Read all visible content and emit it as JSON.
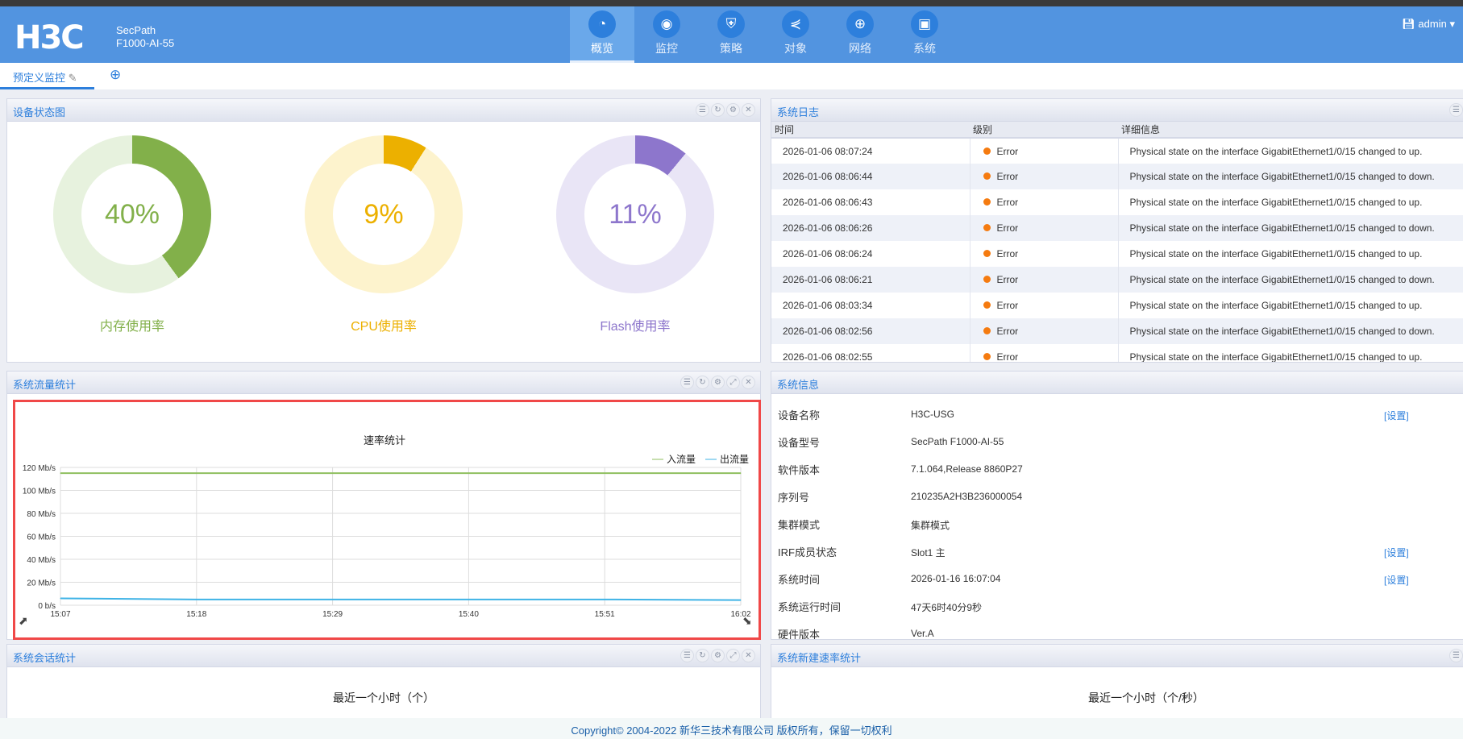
{
  "header": {
    "logo": "H3C",
    "product_line1": "SecPath",
    "product_line2": "F1000-AI-55",
    "user": "admin",
    "nav": [
      {
        "label": "概览",
        "icon": "dashboard-icon",
        "glyph": "◔"
      },
      {
        "label": "监控",
        "icon": "webcam-icon",
        "glyph": "◉"
      },
      {
        "label": "策略",
        "icon": "shield-icon",
        "glyph": "⛨"
      },
      {
        "label": "对象",
        "icon": "share-icon",
        "glyph": "⋞"
      },
      {
        "label": "网络",
        "icon": "globe-icon",
        "glyph": "⊕"
      },
      {
        "label": "系统",
        "icon": "monitor-icon",
        "glyph": "▣"
      }
    ]
  },
  "tabs": {
    "active": "预定义监控",
    "add": "⊕"
  },
  "device_status": {
    "title": "设备状态图",
    "gauges": [
      {
        "label": "内存使用率",
        "value": 40,
        "text": "40%",
        "color": "#82b04a",
        "track": "#e7f2de"
      },
      {
        "label": "CPU使用率",
        "value": 9,
        "text": "9%",
        "color": "#ecb000",
        "track": "#fdf3cd"
      },
      {
        "label": "Flash使用率",
        "value": 11,
        "text": "11%",
        "color": "#8d76cc",
        "track": "#e9e5f6"
      }
    ]
  },
  "syslog": {
    "title": "系统日志",
    "columns": [
      "时间",
      "级别",
      "详细信息"
    ],
    "rows": [
      [
        "2026-01-06 08:07:24",
        "Error",
        "Physical state on the interface GigabitEthernet1/0/15 changed to up."
      ],
      [
        "2026-01-06 08:06:44",
        "Error",
        "Physical state on the interface GigabitEthernet1/0/15 changed to down."
      ],
      [
        "2026-01-06 08:06:43",
        "Error",
        "Physical state on the interface GigabitEthernet1/0/15 changed to up."
      ],
      [
        "2026-01-06 08:06:26",
        "Error",
        "Physical state on the interface GigabitEthernet1/0/15 changed to down."
      ],
      [
        "2026-01-06 08:06:24",
        "Error",
        "Physical state on the interface GigabitEthernet1/0/15 changed to up."
      ],
      [
        "2026-01-06 08:06:21",
        "Error",
        "Physical state on the interface GigabitEthernet1/0/15 changed to down."
      ],
      [
        "2026-01-06 08:03:34",
        "Error",
        "Physical state on the interface GigabitEthernet1/0/15 changed to up."
      ],
      [
        "2026-01-06 08:02:56",
        "Error",
        "Physical state on the interface GigabitEthernet1/0/15 changed to down."
      ],
      [
        "2026-01-06 08:02:55",
        "Error",
        "Physical state on the interface GigabitEthernet1/0/15 changed to up."
      ]
    ]
  },
  "traffic": {
    "title": "系统流量统计"
  },
  "chart_data": {
    "type": "line",
    "title": "速率统计",
    "xlabel": "",
    "ylabel": "",
    "x": [
      "15:07",
      "15:18",
      "15:29",
      "15:40",
      "15:51",
      "16:02"
    ],
    "yticks": [
      "0 b/s",
      "20 Mb/s",
      "40 Mb/s",
      "60 Mb/s",
      "80 Mb/s",
      "100 Mb/s",
      "120 Mb/s"
    ],
    "ylim": [
      0,
      120
    ],
    "legend_position": "top-right",
    "series": [
      {
        "name": "入流量",
        "color": "#8fbf5f",
        "values": [
          115,
          115,
          115,
          115,
          115,
          115
        ]
      },
      {
        "name": "出流量",
        "color": "#3fb3e6",
        "values": [
          6,
          5,
          5,
          5,
          5,
          4.5
        ]
      }
    ]
  },
  "sysinfo": {
    "title": "系统信息",
    "link": "[设置]",
    "rows": [
      {
        "label": "设备名称",
        "value": "H3C-USG",
        "link": true
      },
      {
        "label": "设备型号",
        "value": "SecPath F1000-AI-55",
        "link": false
      },
      {
        "label": "软件版本",
        "value": "7.1.064,Release 8860P27",
        "link": false
      },
      {
        "label": "序列号",
        "value": "210235A2H3B236000054",
        "link": false
      },
      {
        "label": "集群模式",
        "value": "集群模式",
        "link": false
      },
      {
        "label": "IRF成员状态",
        "value": "Slot1 主",
        "link": true
      },
      {
        "label": "系统时间",
        "value": "2026-01-16 16:07:04",
        "link": true
      },
      {
        "label": "系统运行时间",
        "value": "47天6时40分9秒",
        "link": false
      },
      {
        "label": "硬件版本",
        "value": "Ver.A",
        "link": false
      }
    ]
  },
  "sessions": {
    "title": "系统会话统计",
    "subtitle": "最近一个小时（个）"
  },
  "newrate": {
    "title": "系统新建速率统计",
    "subtitle": "最近一个小时（个/秒）"
  },
  "footer": "Copyright© 2004-2022 新华三技术有限公司 版权所有，保留一切权利"
}
